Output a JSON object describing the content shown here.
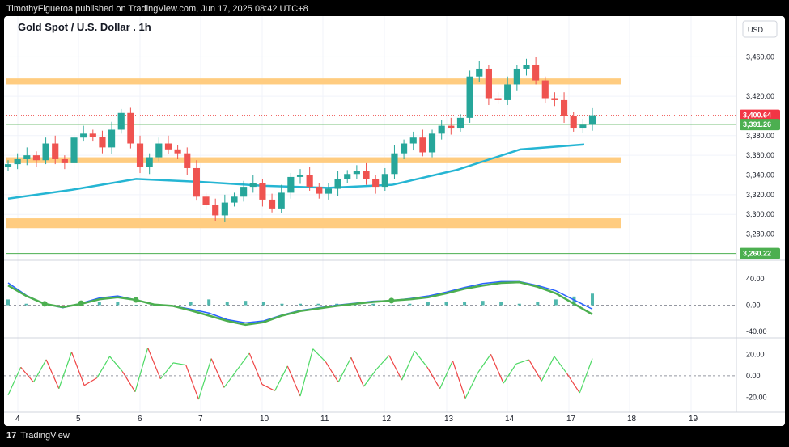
{
  "header": {
    "published": "TimothyFigueroa published on TradingView.com, Jun 17, 2025 08:42 UTC+8"
  },
  "footer": {
    "brand": "TradingView",
    "logo_glyph": "17"
  },
  "chart": {
    "title": "Gold Spot / U.S. Dollar . 1h",
    "currency": "USD",
    "price_label": "3,400.64",
    "ma_label": "3,391.26",
    "support_label": "3,260.22"
  },
  "colors": {
    "up": "#26a69a",
    "down": "#ef5350",
    "ma": "#25b5d3",
    "zone": "#ffcc80",
    "macd_fast": "#2962ff",
    "macd_slow": "#b71c1c",
    "macd_green": "#4caf50",
    "osc_up": "#4cd964",
    "osc_down": "#ef4444"
  },
  "chart_data": [
    {
      "type": "line",
      "title": "Gold Spot / U.S. Dollar . 1h",
      "price_axis_ticks": [
        3460,
        3420,
        3380,
        3360,
        3340,
        3320,
        3300,
        3280
      ],
      "price_axis_tick_labels": [
        "3,460.00",
        "3,420.00",
        "3,380.00",
        "3,360.00",
        "3,340.00",
        "3,320.00",
        "3,300.00",
        "3,280.00"
      ],
      "x_ticks": [
        "4",
        "5",
        "6",
        "7",
        "10",
        "11",
        "12",
        "13",
        "14",
        "17",
        "18",
        "19"
      ],
      "ylim": [
        3255,
        3480
      ],
      "series": [
        {
          "name": "price",
          "values": [
            3351,
            3356,
            3360,
            3355,
            3372,
            3356,
            3352,
            3378,
            3382,
            3379,
            3368,
            3386,
            3403,
            3372,
            3348,
            3358,
            3372,
            3366,
            3362,
            3347,
            3318,
            3310,
            3299,
            3312,
            3318,
            3328,
            3332,
            3315,
            3306,
            3322,
            3338,
            3340,
            3328,
            3321,
            3326,
            3336,
            3341,
            3344,
            3336,
            3328,
            3341,
            3362,
            3372,
            3378,
            3363,
            3382,
            3390,
            3388,
            3398,
            3440,
            3448,
            3418,
            3416,
            3432,
            3448,
            3452,
            3436,
            3418,
            3416,
            3400,
            3388,
            3391,
            3400.64
          ]
        },
        {
          "name": "moving average",
          "values": [
            3316,
            3325,
            3336,
            3333,
            3329,
            3327,
            3330,
            3345,
            3366,
            3371
          ]
        }
      ],
      "zones": [
        [
          3432,
          3438
        ],
        [
          3352,
          3358
        ],
        [
          3286,
          3296
        ]
      ],
      "support_line": 3260.22,
      "current_price": 3400.64,
      "ma_last": 3391.26
    },
    {
      "type": "line",
      "title": "",
      "axis_ticks": [
        40,
        0,
        -40
      ],
      "axis_tick_labels": [
        "40.00",
        "0.00",
        "-40.00"
      ],
      "ylim": [
        -45,
        50
      ],
      "series": [
        {
          "name": "fast",
          "values": [
            34,
            15,
            2,
            -4,
            3,
            11,
            14,
            8,
            1,
            -1,
            -6,
            -12,
            -22,
            -27,
            -24,
            -15,
            -8,
            -4,
            0,
            3,
            6,
            7,
            10,
            14,
            20,
            27,
            33,
            36,
            36,
            30,
            22,
            8,
            -6
          ]
        },
        {
          "name": "slow",
          "values": [
            30,
            14,
            2,
            -3,
            2,
            9,
            12,
            8,
            1,
            -1,
            -8,
            -16,
            -24,
            -30,
            -26,
            -16,
            -9,
            -5,
            -1,
            2,
            5,
            7,
            9,
            12,
            18,
            25,
            30,
            34,
            35,
            28,
            18,
            2,
            -14
          ]
        }
      ]
    },
    {
      "type": "line",
      "title": "",
      "axis_ticks": [
        20,
        0,
        -20
      ],
      "axis_tick_labels": [
        "20.00",
        "0.00",
        "-20.00"
      ],
      "ylim": [
        -28,
        30
      ],
      "series": [
        {
          "name": "oscillator",
          "values": [
            -18,
            8,
            -6,
            15,
            -12,
            22,
            -9,
            -2,
            18,
            4,
            -15,
            26,
            -3,
            12,
            10,
            -22,
            16,
            -11,
            5,
            21,
            -8,
            -14,
            9,
            -19,
            25,
            13,
            -6,
            17,
            -10,
            6,
            19,
            -4,
            23,
            8,
            -12,
            14,
            -21,
            3,
            20,
            -7,
            11,
            15,
            -5,
            18,
            2,
            -16,
            16
          ]
        }
      ]
    }
  ]
}
